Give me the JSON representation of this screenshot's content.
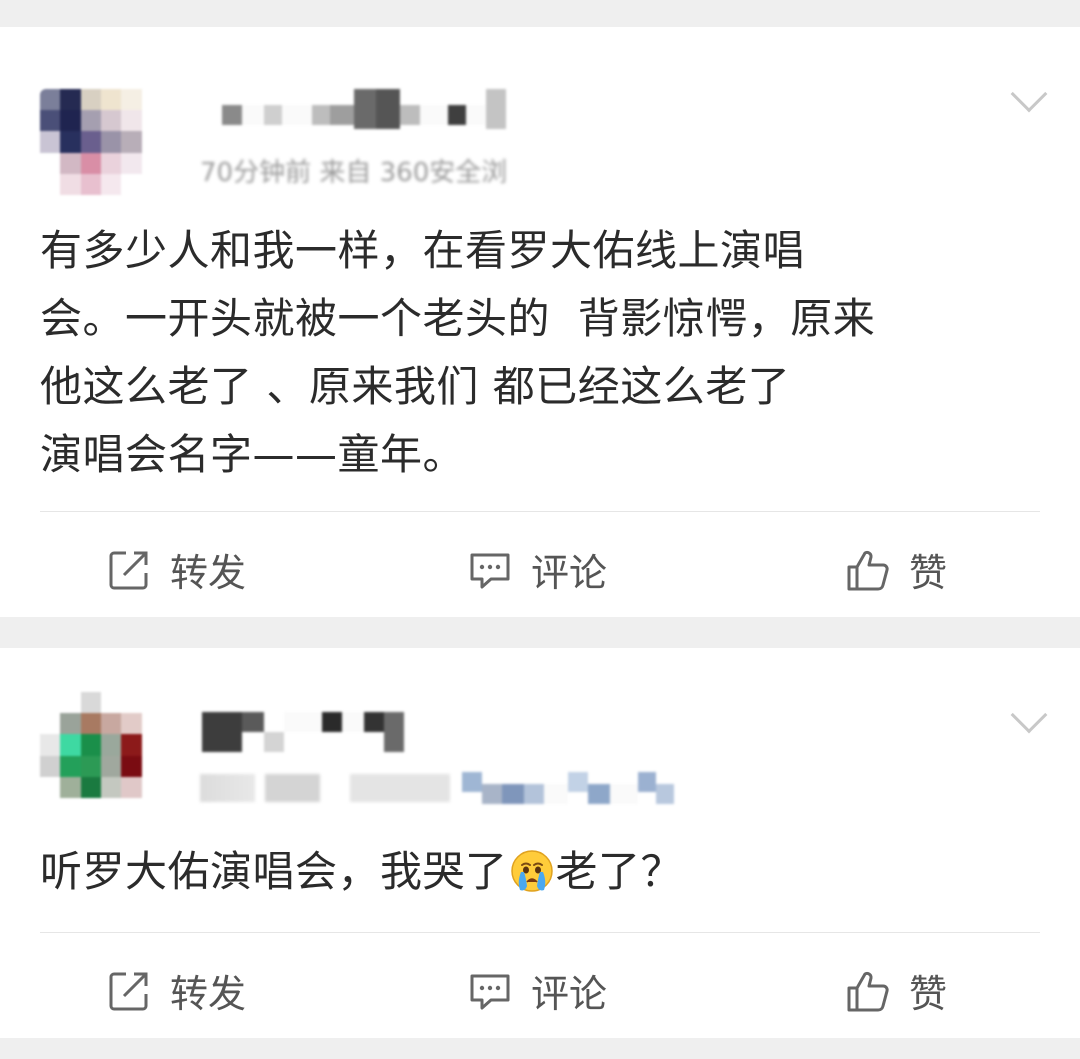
{
  "posts": [
    {
      "meta": "70分钟前 来自 360安全浏",
      "lines": [
        "有多少人和我一样，在看罗大佑线上演唱",
        "会。一开头就被一个老头的  背影惊愕，原来",
        "他这么老了 、原来我们 都已经这么老了",
        "演唱会名字——童年。"
      ],
      "actions": {
        "repost": "转发",
        "comment": "评论",
        "like": "赞"
      }
    },
    {
      "meta": "",
      "text_before_emoji": "听罗大佑演唱会，我哭了",
      "emoji": "crying-face",
      "text_after_emoji": "老了？",
      "actions": {
        "repost": "转发",
        "comment": "评论",
        "like": "赞"
      }
    }
  ],
  "colors": {
    "page_background": "#efefef",
    "card_background": "#ffffff",
    "text": "#2b2b2b",
    "action_text": "#555555",
    "meta_text": "#9a9a9a"
  }
}
